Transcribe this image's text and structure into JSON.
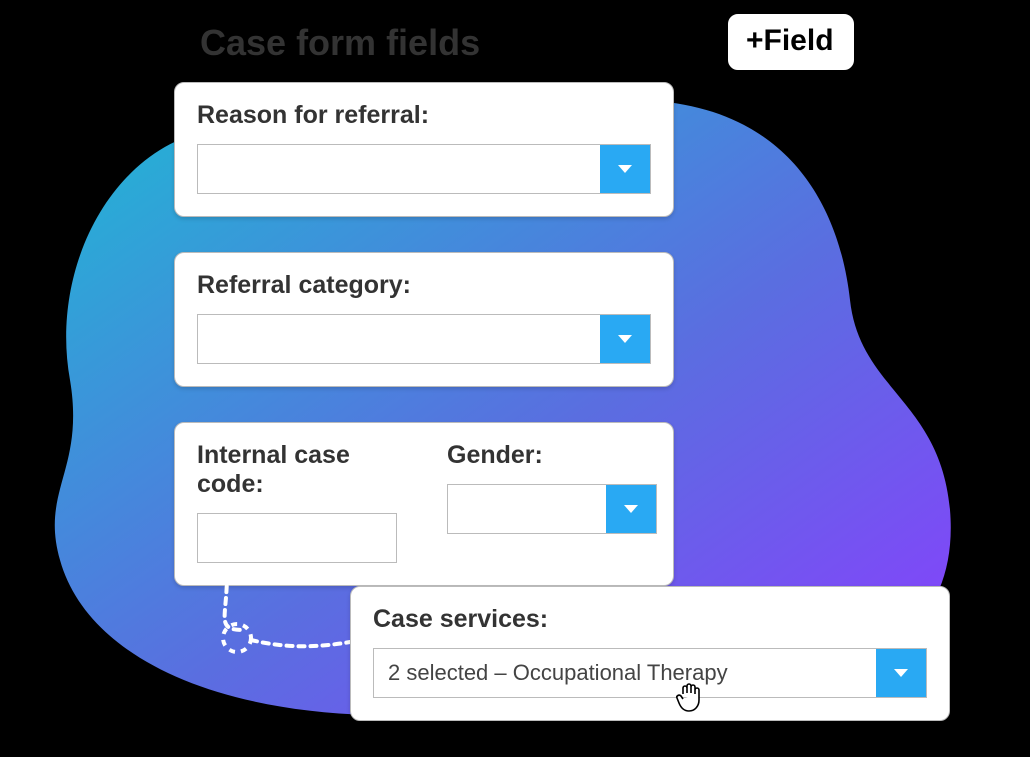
{
  "heading": "Case form fields",
  "add_field_button": "+Field",
  "cards": {
    "referral_reason": {
      "label": "Reason for referral:",
      "value": ""
    },
    "referral_category": {
      "label": "Referral category:",
      "value": ""
    },
    "internal_code": {
      "label": "Internal case code:",
      "value": ""
    },
    "gender": {
      "label": "Gender:",
      "value": ""
    },
    "case_services": {
      "label": "Case services:",
      "value": "2 selected – Occupational Therapy"
    }
  },
  "colors": {
    "accent": "#29a9f3"
  }
}
